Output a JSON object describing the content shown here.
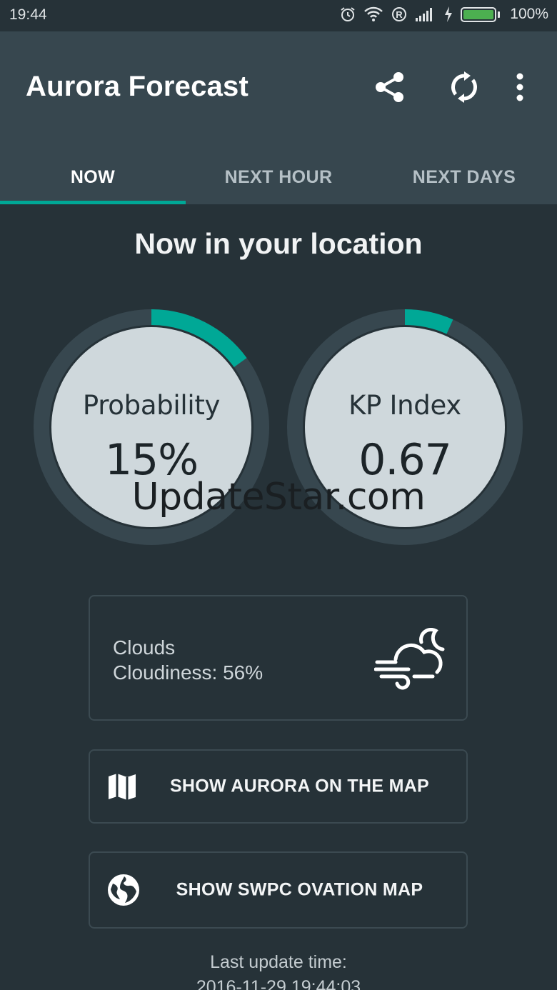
{
  "status_bar": {
    "time": "19:44",
    "battery_percent": "100%",
    "battery_level": 1.0,
    "icons": [
      "alarm-icon",
      "wifi-icon",
      "registered-icon",
      "signal-icon",
      "charging-icon",
      "battery-icon"
    ]
  },
  "app_bar": {
    "title": "Aurora Forecast",
    "actions": [
      "share-icon",
      "refresh-icon",
      "more-vert-icon"
    ]
  },
  "tabs": [
    {
      "label": "NOW",
      "active": true
    },
    {
      "label": "NEXT HOUR",
      "active": false
    },
    {
      "label": "NEXT DAYS",
      "active": false
    }
  ],
  "main": {
    "title": "Now in your location",
    "probability": {
      "label": "Probability",
      "value": "15%",
      "fraction": 0.15
    },
    "kp_index": {
      "label": "KP Index",
      "value": "0.67",
      "fraction": 0.067
    },
    "watermark": "UpdateStar.com",
    "clouds": {
      "title": "Clouds",
      "value": "Cloudiness: 56%",
      "icon": "windy-cloud-icon"
    },
    "buttons": {
      "aurora_map": {
        "label": "SHOW AURORA ON THE MAP",
        "icon": "map-icon"
      },
      "swpc_map": {
        "label": "SHOW SWPC OVATION MAP",
        "icon": "globe-icon"
      }
    },
    "last_update": {
      "label": "Last update time:",
      "value": "2016-11-29 19:44:03"
    }
  },
  "colors": {
    "background": "#263238",
    "app_bar": "#37474f",
    "accent": "#00a896",
    "gauge_track": "#37474f",
    "gauge_face": "#cfd8dc",
    "battery": "#4caf50"
  }
}
